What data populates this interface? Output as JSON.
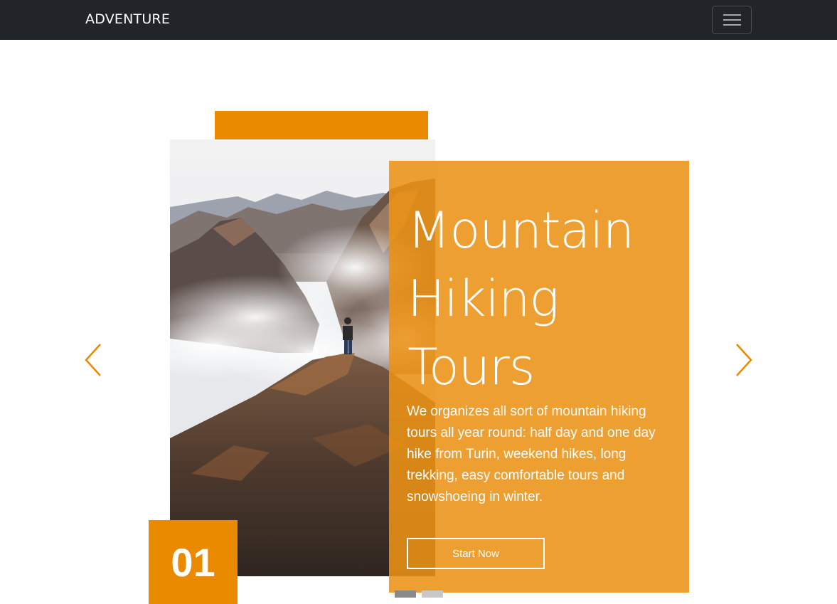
{
  "navbar": {
    "brand": "ADVENTURE",
    "toggler_icon": "hamburger-menu-icon"
  },
  "slide": {
    "title_lines": [
      "Mountain",
      "Hiking",
      "Tours"
    ],
    "description": "We organizes all sort of mountain hiking tours all year round: half day and one day hike from Turin, weekend hikes, long trekking, easy comfortable tours and snowshoeing in winter.",
    "cta_label": "Start Now",
    "number": "01",
    "image_alt": "hiker standing on mountain ridge above clouds"
  },
  "carousel": {
    "prev_icon": "chevron-left-icon",
    "next_icon": "chevron-right-icon",
    "indicators": [
      {
        "active": true
      },
      {
        "active": false
      }
    ]
  },
  "colors": {
    "accent": "#ea8a00",
    "caption_bg": "#ec9214",
    "navbar_bg": "#212529"
  }
}
